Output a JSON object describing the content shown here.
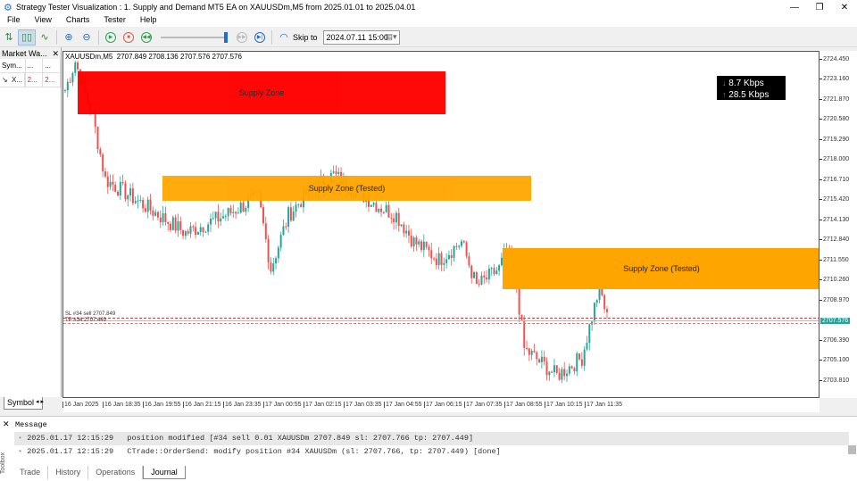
{
  "window": {
    "title": "Strategy Tester Visualization : 1. Supply and Demand MT5 EA on XAUUSDm,M5 from 2025.01.01 to 2025.04.01"
  },
  "menu": [
    "File",
    "View",
    "Charts",
    "Tester",
    "Help"
  ],
  "toolbar": {
    "skip_label": "Skip to",
    "skip_date": "2024.07.11 15:00",
    "speed": 0.95
  },
  "market_watch": {
    "title": "Market Wa...",
    "headers": [
      "Sym...",
      "...",
      "..."
    ],
    "row": [
      "X...",
      "2...",
      "2..."
    ],
    "tab": "Symbol"
  },
  "chart": {
    "header": "XAUUSDm,M5  2707.849 2708.136 2707.576 2707.576",
    "price_labels": [
      "2724.450",
      "2723.160",
      "2721.870",
      "2720.580",
      "2719.290",
      "2718.000",
      "2716.710",
      "2715.420",
      "2714.130",
      "2712.840",
      "2711.550",
      "2710.260",
      "2708.970",
      "2707.576",
      "2706.390",
      "2705.100",
      "2703.810"
    ],
    "current_price": "2707.576",
    "time_labels": [
      "16 Jan 2025",
      "16 Jan 18:35",
      "16 Jan 19:55",
      "16 Jan 21:15",
      "16 Jan 23:35",
      "17 Jan 00:55",
      "17 Jan 02:15",
      "17 Jan 03:35",
      "17 Jan 04:55",
      "17 Jan 06:15",
      "17 Jan 07:35",
      "17 Jan 08:55",
      "17 Jan 10:15",
      "17 Jan 11:35"
    ],
    "zones": [
      {
        "label": "Supply Zone",
        "color": "#ff0000"
      },
      {
        "label": "Supply Zone (Tested)",
        "color": "#ffa500"
      },
      {
        "label": "Supply Zone (Tested)",
        "color": "#ffa500"
      }
    ],
    "line_labels": [
      "SL #34 sell 2707.849",
      "TP #34 2707.449"
    ],
    "net": {
      "down": "8.7 Kbps",
      "up": "28.5 Kbps"
    },
    "up_color": "#26a69a",
    "down_color": "#ef5350"
  },
  "chart_data": {
    "type": "candlestick",
    "symbol": "XAUUSDm",
    "timeframe": "M5",
    "ylim": [
      2703.2,
      2725.3
    ],
    "path": [
      [
        0,
        2722.56
      ],
      [
        4,
        2724.4
      ],
      [
        11,
        2720.84
      ],
      [
        16,
        2716.82
      ],
      [
        32,
        2715.1
      ],
      [
        48,
        2713.38
      ],
      [
        64,
        2714.53
      ],
      [
        77,
        2715.68
      ],
      [
        82,
        2711.09
      ],
      [
        89,
        2714.53
      ],
      [
        98,
        2716.25
      ],
      [
        107,
        2717.11
      ],
      [
        125,
        2715.1
      ],
      [
        132,
        2714.53
      ],
      [
        139,
        2712.81
      ],
      [
        149,
        2711.66
      ],
      [
        158,
        2712.81
      ],
      [
        164,
        2709.94
      ],
      [
        173,
        2711.09
      ],
      [
        176,
        2712.24
      ],
      [
        180,
        2709.94
      ],
      [
        183,
        2705.93
      ],
      [
        196,
        2704.21
      ],
      [
        206,
        2705.36
      ],
      [
        213,
        2709.94
      ],
      [
        216,
        2707.93
      ]
    ]
  },
  "toolbox": {
    "header": "Message",
    "messages": [
      "2025.01.17 12:15:29   position modified [#34 sell 0.01 XAUUSDm 2707.849 sl: 2707.766 tp: 2707.449]",
      "2025.01.17 12:15:29   CTrade::OrderSend: modify position #34 XAUUSDm (sl: 2707.766, tp: 2707.449) [done]"
    ],
    "tabs": [
      "Trade",
      "History",
      "Operations",
      "Journal"
    ],
    "side_label": "Toolbox"
  }
}
